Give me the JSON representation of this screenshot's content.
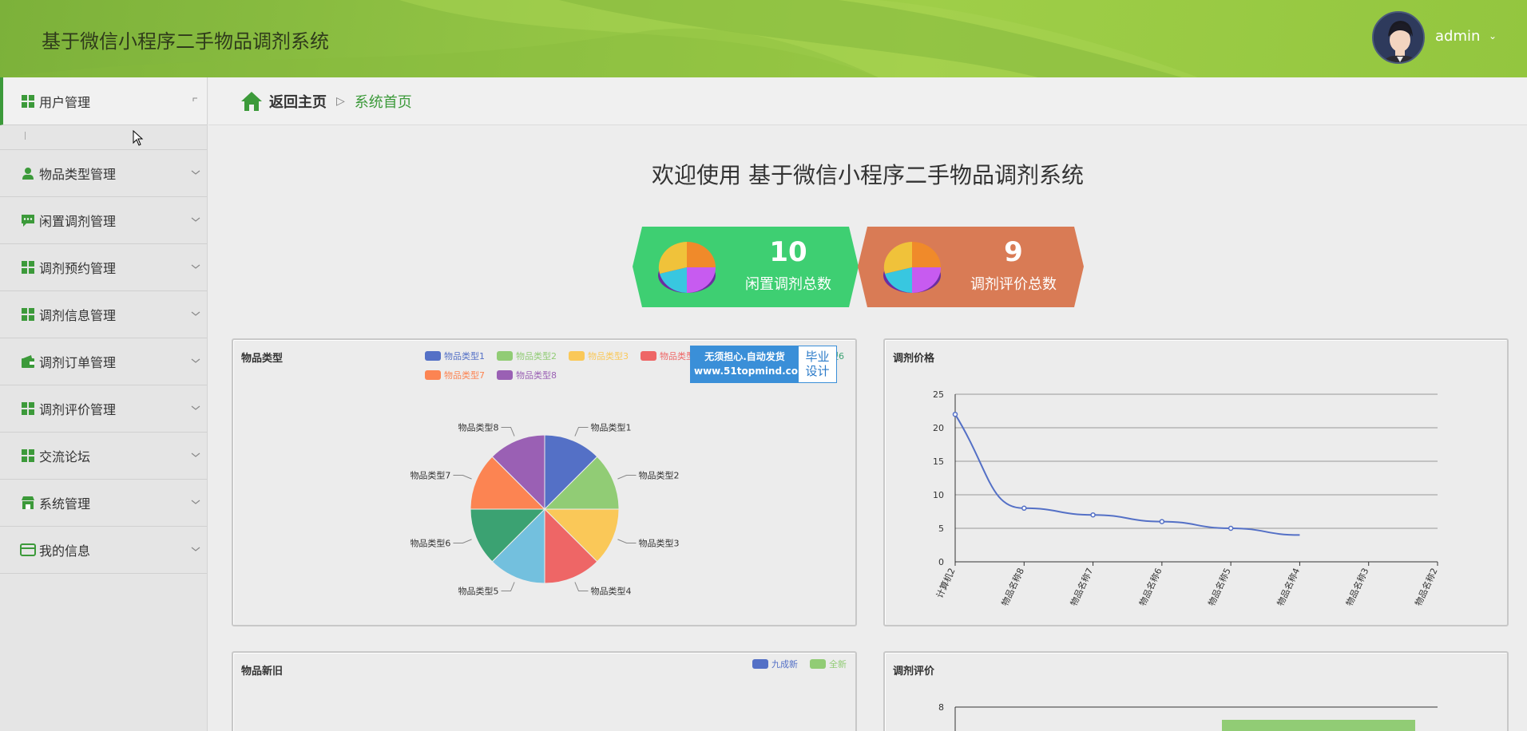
{
  "header": {
    "title": "基于微信小程序二手物品调剂系统",
    "user": "admin",
    "caret": "⌄"
  },
  "sidebar": {
    "items": [
      {
        "label": "用户管理",
        "icon": "grid-icon",
        "active": true
      },
      {
        "label": "物品类型管理",
        "icon": "user-icon"
      },
      {
        "label": "闲置调剂管理",
        "icon": "chat-icon"
      },
      {
        "label": "调剂预约管理",
        "icon": "grid-icon"
      },
      {
        "label": "调剂信息管理",
        "icon": "grid-icon"
      },
      {
        "label": "调剂订单管理",
        "icon": "wallet-icon"
      },
      {
        "label": "调剂评价管理",
        "icon": "grid-icon"
      },
      {
        "label": "交流论坛",
        "icon": "grid-icon"
      },
      {
        "label": "系统管理",
        "icon": "store-icon"
      },
      {
        "label": "我的信息",
        "icon": "card-icon"
      }
    ]
  },
  "breadcrumb": {
    "home": "返回主页",
    "sep": "▷",
    "current": "系统首页"
  },
  "welcome": "欢迎使用 基于微信小程序二手物品调剂系统",
  "stats": [
    {
      "value": "10",
      "label": "闲置调剂总数",
      "color": "#3ecf72"
    },
    {
      "value": "9",
      "label": "调剂评价总数",
      "color": "#d97b55"
    }
  ],
  "watermark": {
    "line1": "无须担心.自动发货",
    "line2": "www.51topmind.com",
    "right1": "毕业",
    "right2": "设计"
  },
  "chart_data": [
    {
      "type": "pie",
      "title": "物品类型",
      "categories": [
        "物品类型1",
        "物品类型2",
        "物品类型3",
        "物品类型4",
        "物品类型5",
        "物品类型6",
        "物品类型7",
        "物品类型8"
      ],
      "values": [
        1,
        1,
        1,
        1,
        1,
        1,
        1,
        1
      ],
      "colors": [
        "#5470c6",
        "#91cc75",
        "#fac858",
        "#ee6666",
        "#73c0de",
        "#3ba272",
        "#fc8452",
        "#9a60b4"
      ],
      "legend": [
        "物品类型1",
        "物品类型2",
        "物品类型3",
        "物品类型4",
        "物品类型5",
        "物品类型6",
        "物品类型7",
        "物品类型8"
      ],
      "legend_placement": "top-right"
    },
    {
      "type": "line",
      "title": "调剂价格",
      "categories": [
        "计算机2",
        "物品名称8",
        "物品名称7",
        "物品名称6",
        "物品名称5",
        "物品名称4",
        "物品名称3",
        "物品名称2"
      ],
      "values": [
        22,
        8,
        7,
        6,
        5,
        4
      ],
      "ylim": [
        0,
        25
      ],
      "yticks": [
        0,
        5,
        10,
        15,
        20,
        25
      ],
      "grid": true,
      "color": "#5470c6"
    },
    {
      "type": "bar",
      "title": "物品新旧",
      "legend": [
        "九成新",
        "全新"
      ],
      "colors": [
        "#5470c6",
        "#91cc75"
      ],
      "legend_placement": "top-right"
    },
    {
      "type": "bar",
      "title": "调剂评价",
      "yticks": [
        8
      ],
      "color": "#91cc75"
    }
  ]
}
